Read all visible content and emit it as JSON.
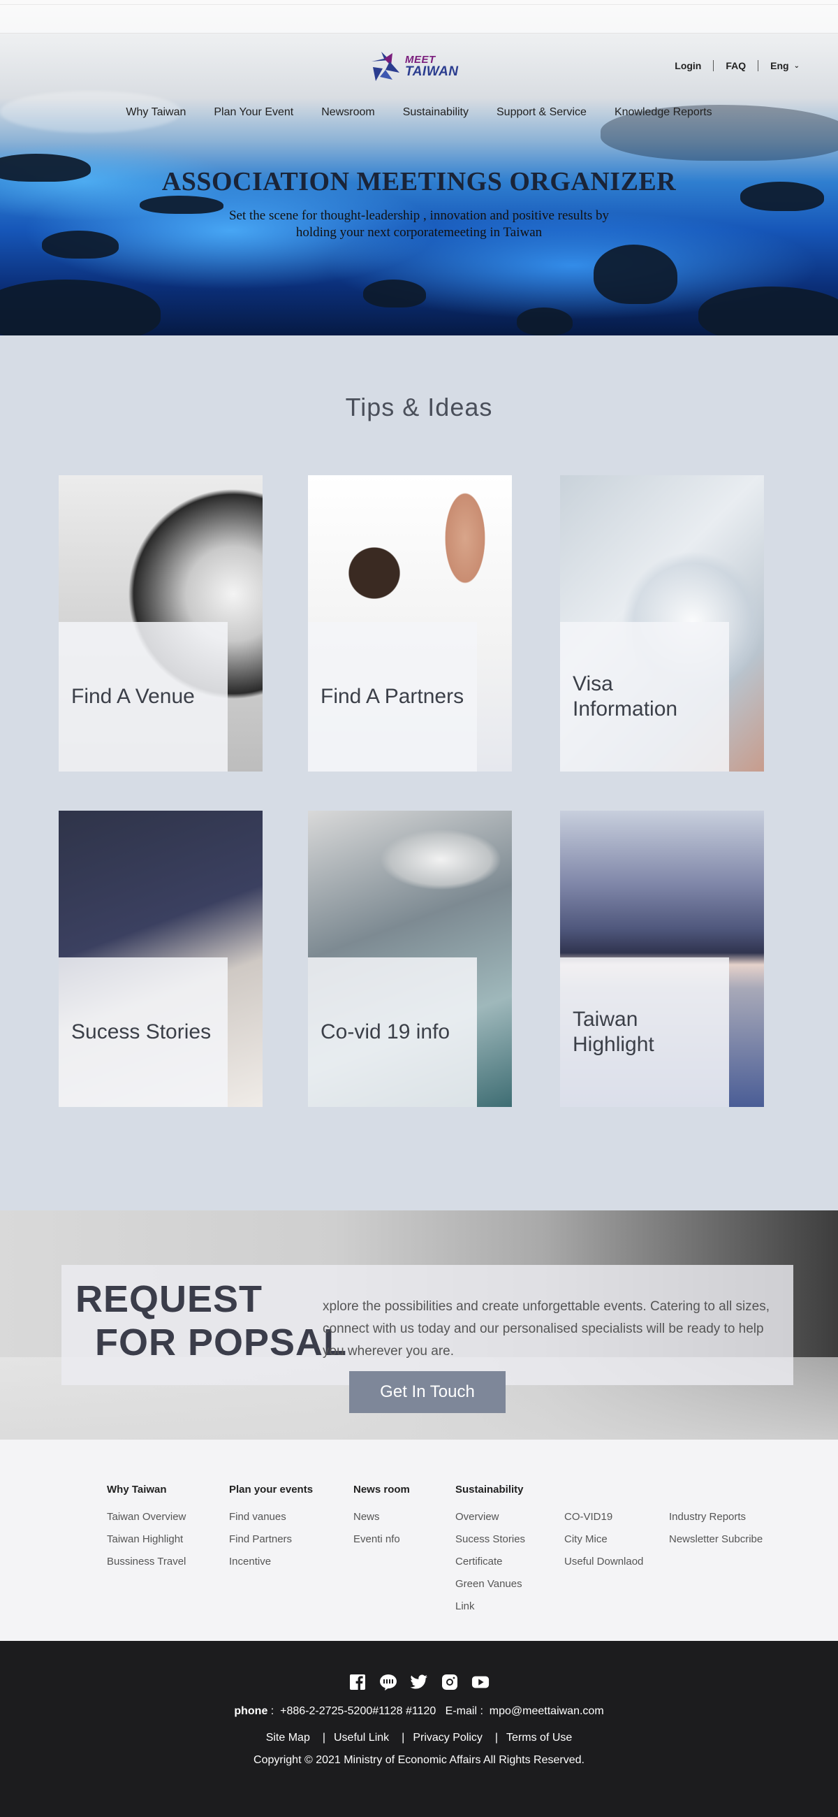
{
  "header": {
    "logo": {
      "line1": "MEET",
      "line2": "TAIWAN"
    },
    "utility": {
      "login": "Login",
      "faq": "FAQ",
      "lang": "Eng"
    },
    "nav": [
      "Why Taiwan",
      "Plan Your Event",
      "Newsroom",
      "Sustainability",
      "Support & Service",
      "Knowledge Reports"
    ]
  },
  "hero": {
    "title": "ASSOCIATION MEETINGS ORGANIZER",
    "subtitle_line1": "Set the scene for thought-leadership , innovation and positive results by",
    "subtitle_line2": "holding your next corporatemeeting in Taiwan"
  },
  "tips": {
    "title": "Tips & Ideas",
    "cards": [
      {
        "label": "Find A Venue"
      },
      {
        "label": "Find A Partners"
      },
      {
        "label_line1": "Visa",
        "label_line2": "Information"
      },
      {
        "label": "Sucess Stories"
      },
      {
        "label": "Co-vid 19 info"
      },
      {
        "label_line1": "Taiwan",
        "label_line2": "Highlight"
      }
    ]
  },
  "request": {
    "heading_line1": "REQUEST",
    "heading_line2": "FOR POPSAL",
    "description": "xplore the possibilities and create unforgettable events. Catering to all sizes, connect with us today and our personalised specialists will be ready to help you wherever you are.",
    "button": "Get In Touch"
  },
  "footer_links": {
    "why_taiwan": {
      "heading": "Why Taiwan",
      "items": [
        "Taiwan Overview",
        "Taiwan Highlight",
        "Bussiness Travel"
      ]
    },
    "plan": {
      "heading": "Plan your events",
      "items": [
        "Find vanues",
        "Find Partners",
        "Incentive"
      ]
    },
    "newsroom": {
      "heading": "News room",
      "items": [
        "News",
        "Eventi nfo"
      ]
    },
    "sustainability": {
      "heading": "Sustainability",
      "items": [
        "Overview",
        "Sucess Stories",
        "Certificate",
        "Green Vanues",
        "Link"
      ]
    },
    "more1": {
      "items": [
        "CO-VID19",
        "City Mice",
        "Useful Downlaod"
      ]
    },
    "more2": {
      "items": [
        "Industry Reports",
        "Newsletter Subcribe"
      ]
    }
  },
  "bottom": {
    "social_icons": [
      "facebook-icon",
      "line-icon",
      "twitter-icon",
      "instagram-icon",
      "youtube-icon"
    ],
    "phone_label": "phone",
    "phone": "+886-2-2725-5200#1128 #1120",
    "email_label": "E-mail",
    "email": "mpo@meettaiwan.com",
    "legal": [
      "Site Map",
      "Useful Link",
      "Privacy Policy",
      "Terms of Use"
    ],
    "copyright": "Copyright © 2021 Ministry of Economic Affairs All Rights Reserved."
  },
  "colors": {
    "page_bg": "#d6dce5",
    "button_bg": "#7e8799",
    "footer_bg": "#1c1c1e",
    "logo_purple": "#7a1d7c",
    "logo_blue": "#2b3d8f"
  }
}
